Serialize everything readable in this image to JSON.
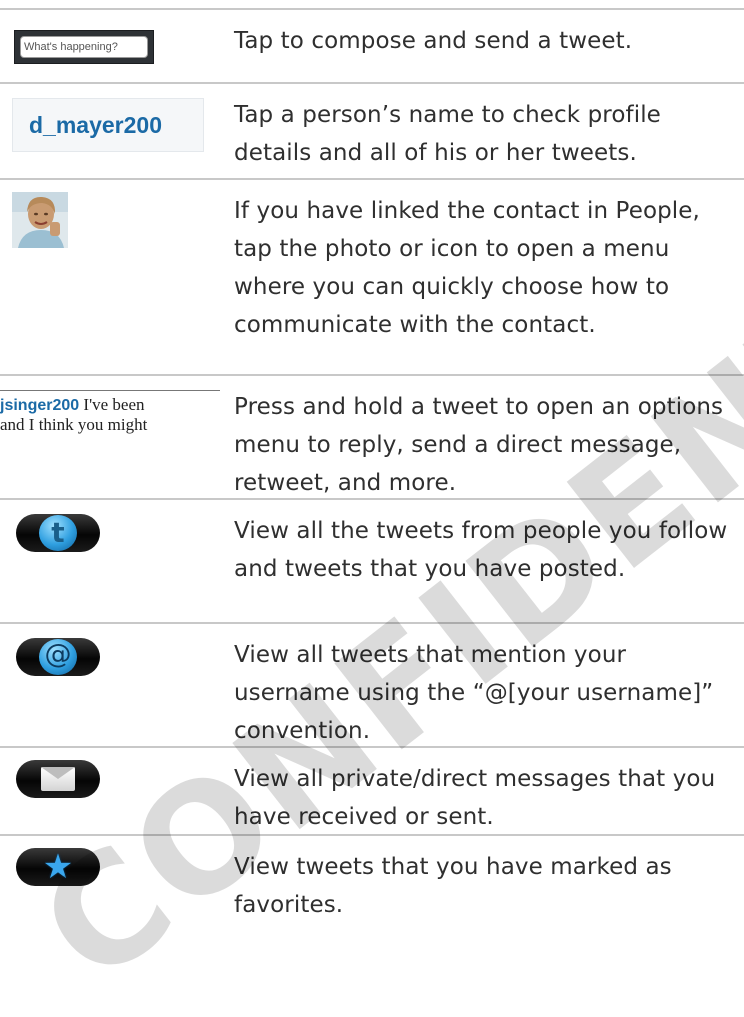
{
  "rows": [
    {
      "icon": "compose-box",
      "icon_text": "What's happening?",
      "description": "Tap to compose and send a tweet."
    },
    {
      "icon": "username-link",
      "icon_text": "d_mayer200",
      "description": "Tap a person’s name to check profile details and all of his or her tweets."
    },
    {
      "icon": "contact-photo",
      "description": "If you have linked the contact in People, tap the photo or icon to open a menu where you can quickly choose how to communicate with the contact."
    },
    {
      "icon": "tweet-preview",
      "icon_user": "jsinger200",
      "icon_line1": " I've been",
      "icon_line2": "and I think you might",
      "description": "Press and hold a tweet to open an options menu to reply, send a direct message, retweet, and more."
    },
    {
      "icon": "twitter-tab-icon",
      "description": "View all the tweets from people you follow and tweets that you have posted."
    },
    {
      "icon": "mentions-tab-icon",
      "glyph": "@",
      "description": "View all tweets that mention your username using the “@[your username]” convention."
    },
    {
      "icon": "messages-tab-icon",
      "description": "View all private/direct messages that you have received or sent."
    },
    {
      "icon": "favorites-tab-icon",
      "glyph": "★",
      "description": "View tweets that you have marked as favorites."
    }
  ],
  "watermark": "CONFIDENTIAL"
}
